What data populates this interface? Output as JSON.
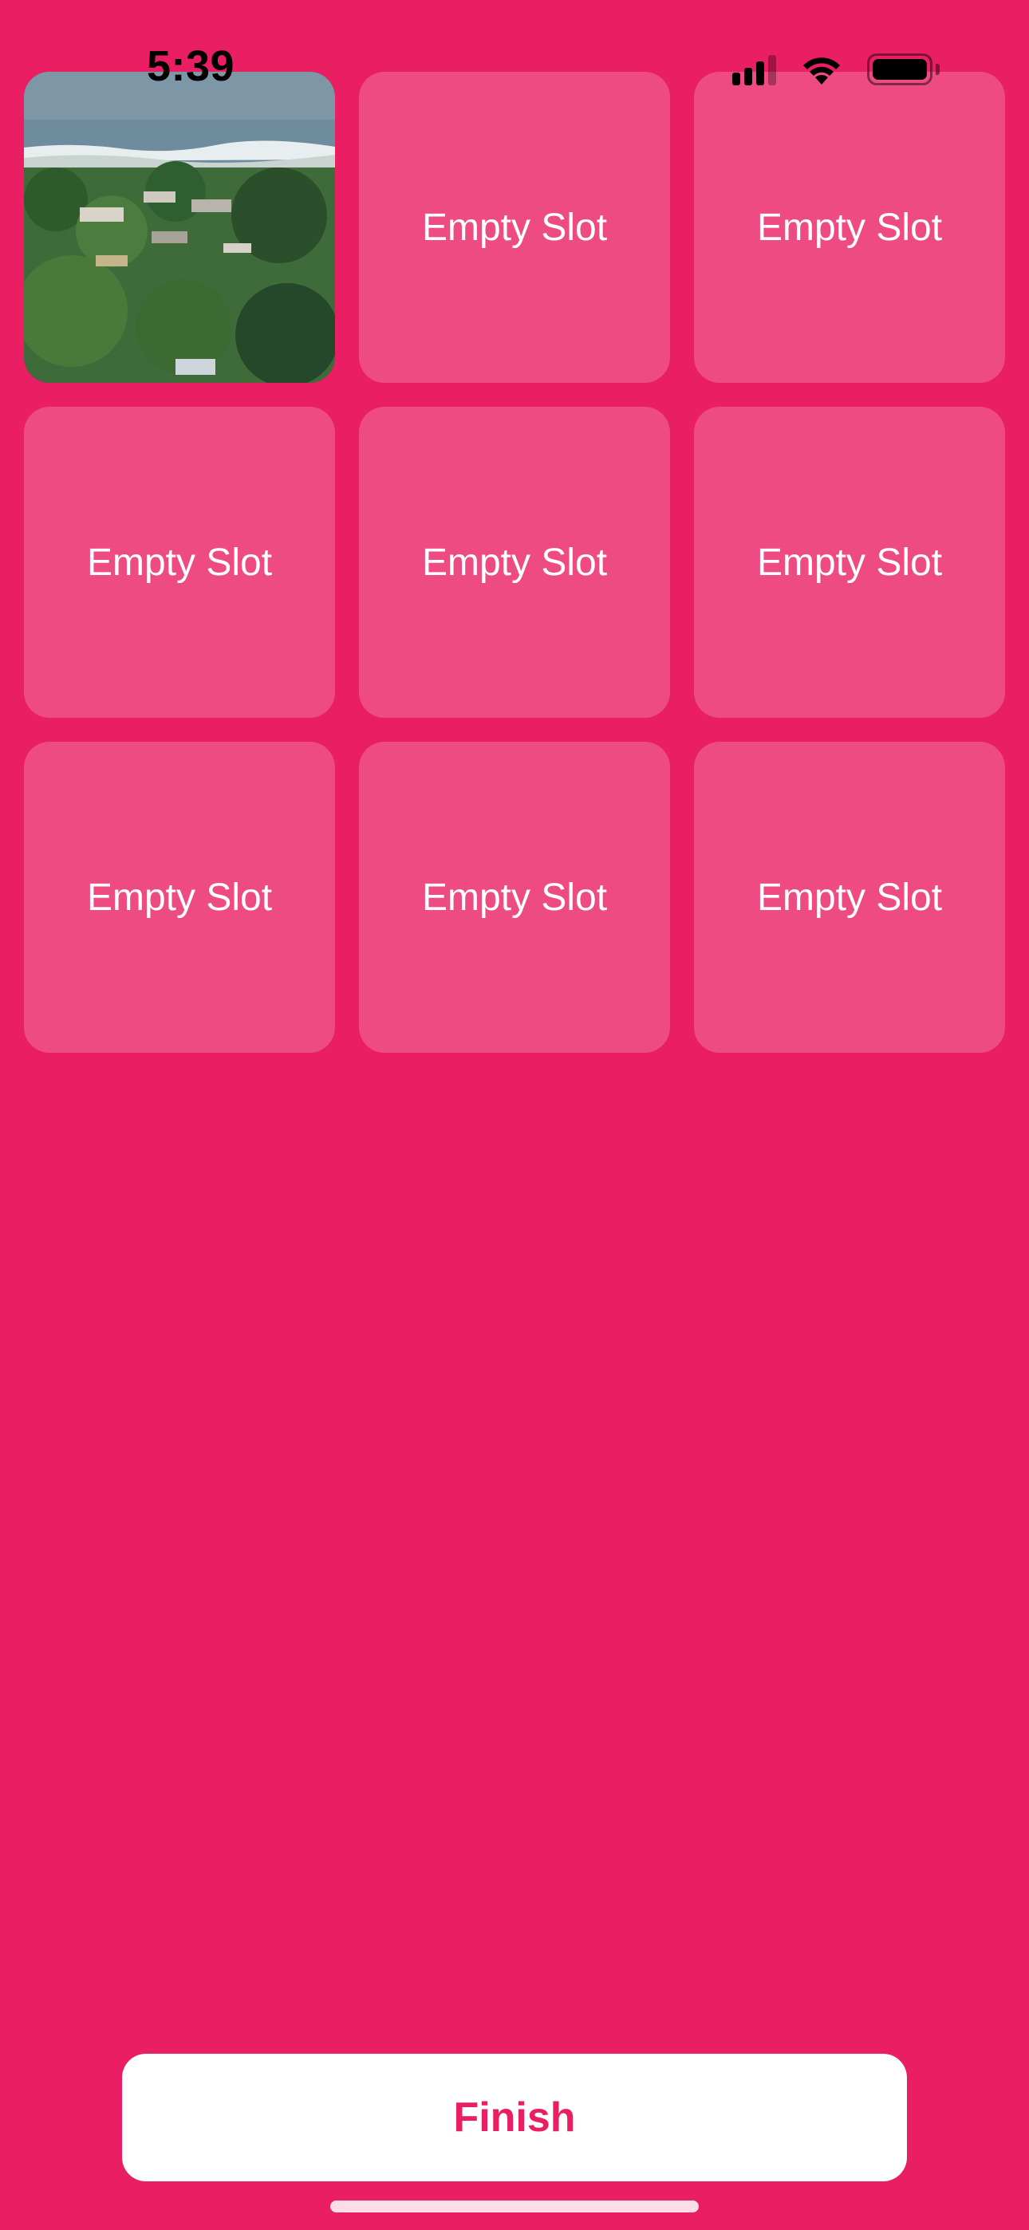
{
  "status_bar": {
    "time": "5:39"
  },
  "colors": {
    "background": "#E91E63",
    "slot_fill": "rgba(255,255,255,0.2)",
    "button_bg": "#FFFFFF",
    "button_text": "#E91E63"
  },
  "slots": [
    {
      "type": "photo",
      "label": ""
    },
    {
      "type": "empty",
      "label": "Empty Slot"
    },
    {
      "type": "empty",
      "label": "Empty Slot"
    },
    {
      "type": "empty",
      "label": "Empty Slot"
    },
    {
      "type": "empty",
      "label": "Empty Slot"
    },
    {
      "type": "empty",
      "label": "Empty Slot"
    },
    {
      "type": "empty",
      "label": "Empty Slot"
    },
    {
      "type": "empty",
      "label": "Empty Slot"
    },
    {
      "type": "empty",
      "label": "Empty Slot"
    }
  ],
  "finish_button": {
    "label": "Finish"
  },
  "icons": {
    "signal": "cellular-signal-icon",
    "wifi": "wifi-icon",
    "battery": "battery-icon",
    "photo": "coastal-landscape-photo"
  }
}
